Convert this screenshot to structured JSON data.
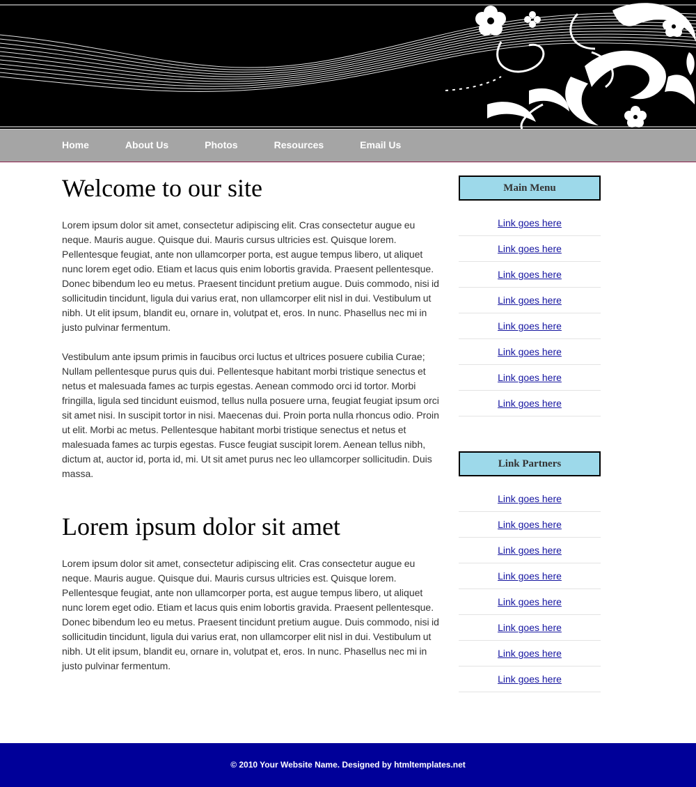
{
  "nav": {
    "items": [
      {
        "label": "Home"
      },
      {
        "label": "About Us"
      },
      {
        "label": "Photos"
      },
      {
        "label": "Resources"
      },
      {
        "label": "Email Us"
      }
    ]
  },
  "main": {
    "welcome_title": "Welcome to our site",
    "para1": "Lorem ipsum dolor sit amet, consectetur adipiscing elit. Cras consectetur augue eu neque. Mauris augue. Quisque dui. Mauris cursus ultricies est. Quisque lorem. Pellentesque feugiat, ante non ullamcorper porta, est augue tempus libero, ut aliquet nunc lorem eget odio. Etiam et lacus quis enim lobortis gravida. Praesent pellentesque. Donec bibendum leo eu metus. Praesent tincidunt pretium augue. Duis commodo, nisi id sollicitudin tincidunt, ligula dui varius erat, non ullamcorper elit nisl in dui. Vestibulum ut nibh. Ut elit ipsum, blandit eu, ornare in, volutpat et, eros. In nunc. Phasellus nec mi in justo pulvinar fermentum.",
    "para2": "Vestibulum ante ipsum primis in faucibus orci luctus et ultrices posuere cubilia Curae; Nullam pellentesque purus quis dui. Pellentesque habitant morbi tristique senectus et netus et malesuada fames ac turpis egestas. Aenean commodo orci id tortor. Morbi fringilla, ligula sed tincidunt euismod, tellus nulla posuere urna, feugiat feugiat ipsum orci sit amet nisi. In suscipit tortor in nisi. Maecenas dui. Proin porta nulla rhoncus odio. Proin ut elit. Morbi ac metus. Pellentesque habitant morbi tristique senectus et netus et malesuada fames ac turpis egestas. Fusce feugiat suscipit lorem. Aenean tellus nibh, dictum at, auctor id, porta id, mi. Ut sit amet purus nec leo ullamcorper sollicitudin. Duis massa.",
    "second_title": "Lorem ipsum dolor sit amet",
    "para3": "Lorem ipsum dolor sit amet, consectetur adipiscing elit. Cras consectetur augue eu neque. Mauris augue. Quisque dui. Mauris cursus ultricies est. Quisque lorem. Pellentesque feugiat, ante non ullamcorper porta, est augue tempus libero, ut aliquet nunc lorem eget odio. Etiam et lacus quis enim lobortis gravida. Praesent pellentesque. Donec bibendum leo eu metus. Praesent tincidunt pretium augue. Duis commodo, nisi id sollicitudin tincidunt, ligula dui varius erat, non ullamcorper elit nisl in dui. Vestibulum ut nibh. Ut elit ipsum, blandit eu, ornare in, volutpat et, eros. In nunc. Phasellus nec mi in justo pulvinar fermentum."
  },
  "sidebar": {
    "main_menu_title": "Main Menu",
    "main_menu_links": [
      "Link goes here",
      "Link goes here",
      "Link goes here",
      "Link goes here",
      "Link goes here",
      "Link goes here",
      "Link goes here",
      "Link goes here"
    ],
    "partners_title": "Link Partners",
    "partner_links": [
      "Link goes here",
      "Link goes here",
      "Link goes here",
      "Link goes here",
      "Link goes here",
      "Link goes here",
      "Link goes here",
      "Link goes here"
    ]
  },
  "footer": {
    "text": "© 2010 Your Website Name. Designed by htmltemplates.net"
  },
  "colors": {
    "header_bg": "#000000",
    "nav_bg": "#a5a5a5",
    "sidebar_heading_bg": "#9dd9ea",
    "link": "#1515a0",
    "footer_bg": "#000099"
  }
}
